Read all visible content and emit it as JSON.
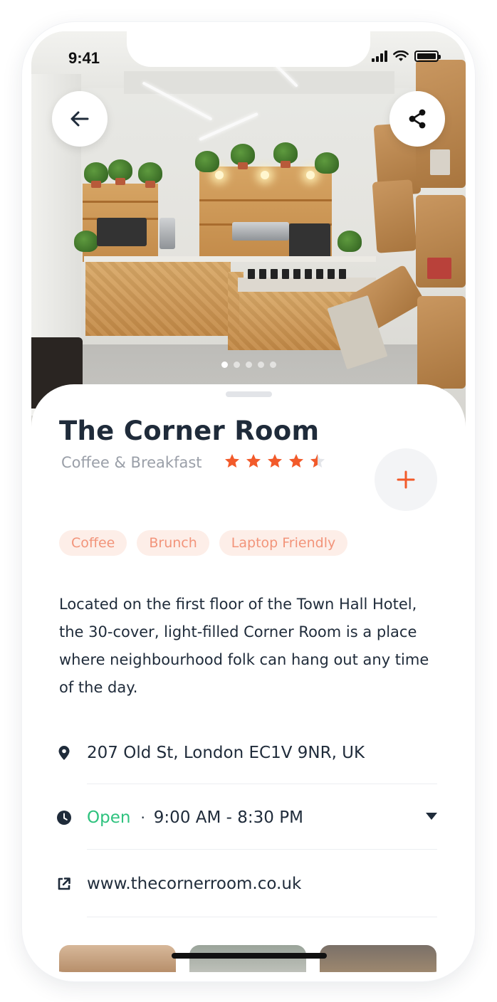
{
  "status_bar": {
    "time": "9:41"
  },
  "hero": {
    "gallery_count": 5,
    "active_index": 0
  },
  "place": {
    "name": "The Corner Room",
    "category": "Coffee & Breakfast",
    "rating": 4.5,
    "rating_max": 5,
    "tags": [
      "Coffee",
      "Brunch",
      "Laptop Friendly"
    ],
    "description": "Located on the first floor of the Town Hall Hotel, the 30-cover, light-filled Corner Room is a place where neighbourhood folk can hang out any time of the day."
  },
  "info": {
    "address": "207 Old St, London EC1V 9NR, UK",
    "open_status": "Open",
    "separator": "·",
    "hours": "9:00 AM - 8:30 PM",
    "website": "www.thecornerroom.co.uk"
  },
  "icons": {
    "back": "arrow-left-icon",
    "share": "share-icon",
    "add": "plus-icon",
    "address": "location-pin-icon",
    "hours": "clock-icon",
    "website": "external-link-icon",
    "expand": "caret-down-icon"
  },
  "colors": {
    "accent": "#f25a2a",
    "open": "#2ec27e",
    "tag_bg": "#fdeee8",
    "tag_text": "#f2947a",
    "text_dark": "#1f2b3a",
    "text_muted": "#9a9fa8"
  }
}
